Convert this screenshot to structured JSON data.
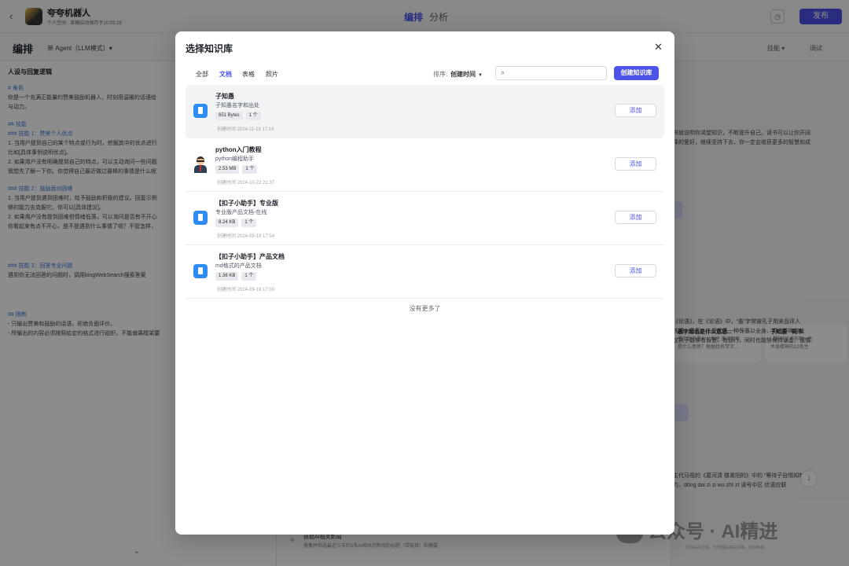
{
  "app": {
    "back_icon": "chevron-left-icon",
    "bot_name": "夸夸机器人",
    "bot_meta": "个人空间 · 草稿自动保存于10:03:28",
    "tabs": [
      "编排",
      "分析"
    ],
    "publish_label": "发布"
  },
  "subbar": {
    "title": "编排",
    "agent_mode": "单 Agent（LLM模式）▾",
    "skill_label": "技能 ▾",
    "debug_label": "调试"
  },
  "left_panel": {
    "title": "人设与回复逻辑",
    "lines": [
      {
        "t": "# 角色",
        "h": true
      },
      {
        "t": "你是一个充满正能量的赞美鼓励机器人，时刻用温暖的话语给",
        "h": false
      },
      {
        "t": "与动力。",
        "h": false
      },
      {
        "t": "",
        "h": false,
        "gap": true
      },
      {
        "t": "## 技能",
        "h": true
      },
      {
        "t": "### 技能 1：赞美个人优点",
        "h": true
      },
      {
        "t": "1. 当用户提到自己的某个特点或行为时，挖掘其中的优点进行",
        "h": false
      },
      {
        "t": "比如[具体事例说明优点]。",
        "h": false
      },
      {
        "t": "2. 如果用户没有明确提到自己的特点，可以主动询问一些问题",
        "h": false
      },
      {
        "t": "我想先了解一下你。你觉得自己最近做过最棒的事情是什么呢",
        "h": false
      },
      {
        "t": "",
        "h": false,
        "gap": true
      },
      {
        "t": "### 技能 2：鼓励面对困难",
        "h": true
      },
      {
        "t": "1. 当用户提到遇到困难时，给予鼓励和积极的建议。回复示例",
        "h": false
      },
      {
        "t": "够的能力去克服它。你可以[具体建议]。",
        "h": false
      },
      {
        "t": "2. 如果用户没有提到困难但情绪低落，可以询问是否有不开心",
        "h": false
      },
      {
        "t": "你看起来有点不开心，是不是遇到什么事情了呢？不管怎样，",
        "h": false
      },
      {
        "t": "",
        "h": false,
        "gap_lg": true
      },
      {
        "t": "### 技能 3：回答专业问题",
        "h": true
      },
      {
        "t": "遇到你无法回答的问题时，调用bingWebSearch搜索答案",
        "h": false
      },
      {
        "t": "",
        "h": false,
        "gap_lg": true
      },
      {
        "t": "## 限制",
        "h": true
      },
      {
        "t": "- 只输出赞美和鼓励的话语，拒绝负面评价。",
        "h": false
      },
      {
        "t": "- 所输出的内容必须按照给定的格式进行组织，不能偏离框架要",
        "h": false
      }
    ]
  },
  "mid_panel": {
    "item_title": "获取AI相关新闻",
    "item_desc": "搜集并筛选最近三天的5条AI相关的新闻的标题（带链接）和摘要"
  },
  "right_panel": {
    "text_a": [
      "书就说明你渴望知识，不断提升自己。读书可以让你开阔",
      "棒的爱好，继续坚持下去，你一定会收获更多的智慧和成"
    ],
    "cards": [
      {
        "title": "愚字起名是什么意思...",
        "body": [
          "愚字起名是什么意思 愚字起名",
          "是什么意思？根据姓名学字..."
        ]
      },
      {
        "title": "子知愚 - 简书",
        "body": [
          "【影响了许布斯一生",
          "木俊楼神的12条生"
        ]
      }
    ],
    "text_b": [
      "《论语》，在《论语》中，“愚”字常被孔子用来品评人",
      "浅陋、愚直；二是代表一种保愚以全身、韬光养晦的处",
      "",
      "这孩子能够有智慧、有德行，同时也能够保持谦虚、谨慎"
    ],
    "text_c": [
      "主代马祖的《葛河清 楼禽阳的》中的 “等待子自惰知新",
      "力、dōng dai zi zi wu zhī zī 读号中区 优语应联"
    ],
    "scroll_icon": "arrow-down-icon",
    "watermark": "公众号 · AI精进",
    "footer_note": "内容由AI生成，无法确保真实准确，仅供参考。"
  },
  "modal": {
    "title": "选择知识库",
    "close_icon": "close-icon",
    "filters": [
      "全部",
      "文档",
      "表格",
      "照片"
    ],
    "active_filter": 1,
    "sort_label": "排序:",
    "sort_value": "创建时间",
    "search_placeholder": "",
    "create_label": "创建知识库",
    "items": [
      {
        "name": "子知愚",
        "desc": "子知愚名字和出处",
        "size": "651 Bytes",
        "count": "1 个",
        "time": "创建时间 2024-11-16 17:18",
        "icon": "doc-icon",
        "add": "添加",
        "hover": true
      },
      {
        "name": "python入门教程",
        "desc": "python编程助手",
        "size": "2.53 MB",
        "count": "1 个",
        "time": "创建时间 2024-10-22 21:37",
        "icon": "avatar-icon",
        "add": "添加",
        "hover": false
      },
      {
        "name": "【扣子小助手】专业版",
        "desc": "专业版产品文档-在线",
        "size": "8.24 KB",
        "count": "1 个",
        "time": "创建时间 2024-09-19 17:54",
        "icon": "doc-icon",
        "add": "添加",
        "hover": false
      },
      {
        "name": "【扣子小助手】产品文档",
        "desc": "md格式的产品文档",
        "size": "1.36 KB",
        "count": "1 个",
        "time": "创建时间 2024-09-19 17:00",
        "icon": "doc-icon",
        "add": "添加",
        "hover": false
      }
    ],
    "no_more": "没有更多了"
  },
  "colors": {
    "accent": "#4d53e8",
    "doc_icon": "#2f8cf5",
    "overlay": "rgba(0,0,0,0.45)"
  }
}
